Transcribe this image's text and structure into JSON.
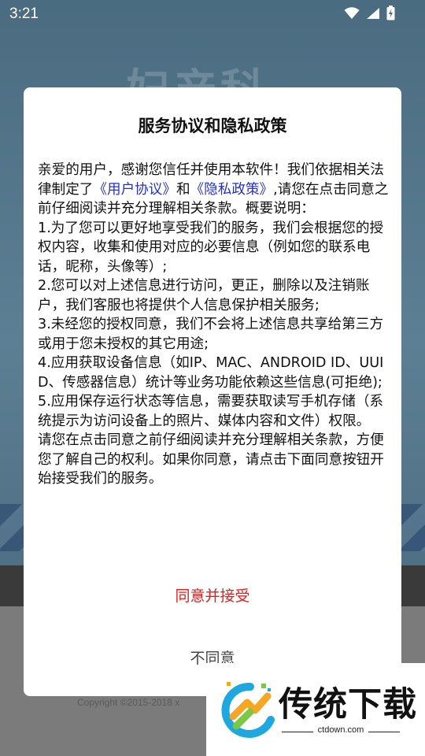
{
  "status_bar": {
    "time": "3:21"
  },
  "background": {
    "title": "妇产科",
    "copyright": "Copyright ©2015-2018 x"
  },
  "dialog": {
    "title": "服务协议和隐私政策",
    "body": {
      "p1_before": "亲爱的用户，感谢您信任并使用本软件！我们依据相关法律制定了",
      "user_agreement_link": "《用户协议》",
      "and": "和",
      "privacy_policy_link": "《隐私政策》",
      "p1_after": ",请您在点击同意之前仔细阅读并充分理解相关条款。概要说明：",
      "item1": "1.为了您可以更好地享受我们的服务，我们会根据您的授权内容，收集和使用对应的必要信息（例如您的联系电话，昵称，头像等）;",
      "item2": "2.您可以对上述信息进行访问，更正，删除以及注销账户，我们客服也将提供个人信息保护相关服务;",
      "item3": "3.未经您的授权同意，我们不会将上述信息共享给第三方或用于您未授权的其它用途;",
      "item4": "4.应用获取设备信息（如IP、MAC、ANDROID ID、UUID、传感器信息）统计等业务功能依赖这些信息(可拒绝);",
      "item5": "5.应用保存运行状态等信息，需要获取读写手机存储（系统提示为访问设备上的照片、媒体内容和文件）权限。",
      "closing": "请您在点击同意之前仔细阅读并充分理解相关条款，方便您了解自己的权利。如果你同意，请点击下面同意按钮开始接受我们的服务。"
    },
    "agree_label": "同意并接受",
    "disagree_label": "不同意"
  },
  "watermark": {
    "brand": "传统下载",
    "url": "ctdown.com"
  },
  "icons": [
    "wifi-icon",
    "signal-icon",
    "battery-icon",
    "logo-icon"
  ],
  "colors": {
    "link": "#2432c8",
    "agree": "#e21f1f"
  }
}
